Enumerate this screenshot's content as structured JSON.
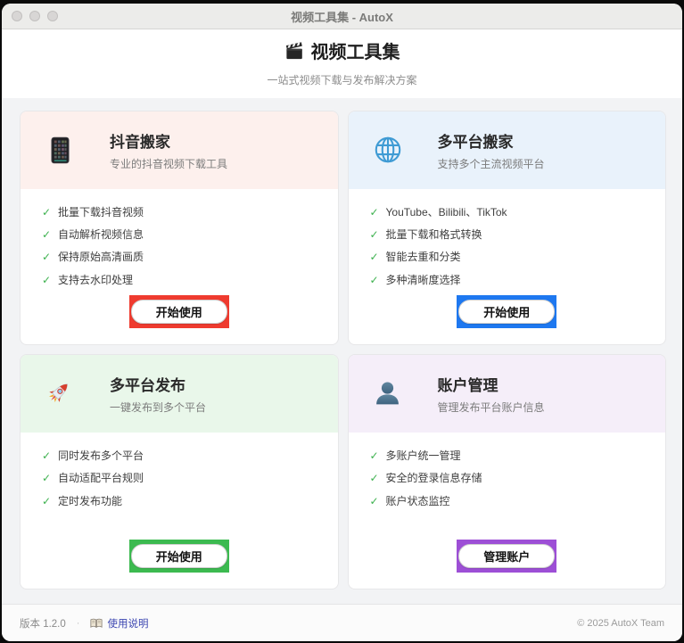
{
  "window": {
    "title": "视频工具集 - AutoX"
  },
  "titlebar_buttons": [
    "close",
    "minimize",
    "zoom"
  ],
  "header": {
    "icon": "clapperboard-icon",
    "title": "视频工具集",
    "subtitle": "一站式视频下载与发布解决方案"
  },
  "cards": [
    {
      "icon": "phone-icon",
      "title": "抖音搬家",
      "subtitle": "专业的抖音视频下载工具",
      "features": [
        "批量下载抖音视频",
        "自动解析视频信息",
        "保持原始高清画质",
        "支持去水印处理"
      ],
      "button": "开始使用",
      "accent": "#ef3b2f",
      "tint": "#fdf0ed"
    },
    {
      "icon": "globe-icon",
      "title": "多平台搬家",
      "subtitle": "支持多个主流视频平台",
      "features": [
        "YouTube、Bilibili、TikTok",
        "批量下载和格式转换",
        "智能去重和分类",
        "多种清晰度选择"
      ],
      "button": "开始使用",
      "accent": "#1e78f0",
      "tint": "#e9f2fb"
    },
    {
      "icon": "rocket-icon",
      "title": "多平台发布",
      "subtitle": "一键发布到多个平台",
      "features": [
        "同时发布多个平台",
        "自动适配平台规则",
        "定时发布功能"
      ],
      "button": "开始使用",
      "accent": "#3cba50",
      "tint": "#e9f7ea"
    },
    {
      "icon": "user-icon",
      "title": "账户管理",
      "subtitle": "管理发布平台账户信息",
      "features": [
        "多账户统一管理",
        "安全的登录信息存储",
        "账户状态监控"
      ],
      "button": "管理账户",
      "accent": "#9d4fd6",
      "tint": "#f5eef9"
    }
  ],
  "colors": {
    "check": "#3db14e",
    "link": "#3a44b0",
    "card_accents": [
      "#ef3b2f",
      "#1e78f0",
      "#3cba50",
      "#9d4fd6"
    ]
  },
  "footer": {
    "version": "版本 1.2.0",
    "separator": "·",
    "help_icon": "book-icon",
    "help_link": "使用说明",
    "copyright": "© 2025 AutoX Team"
  }
}
